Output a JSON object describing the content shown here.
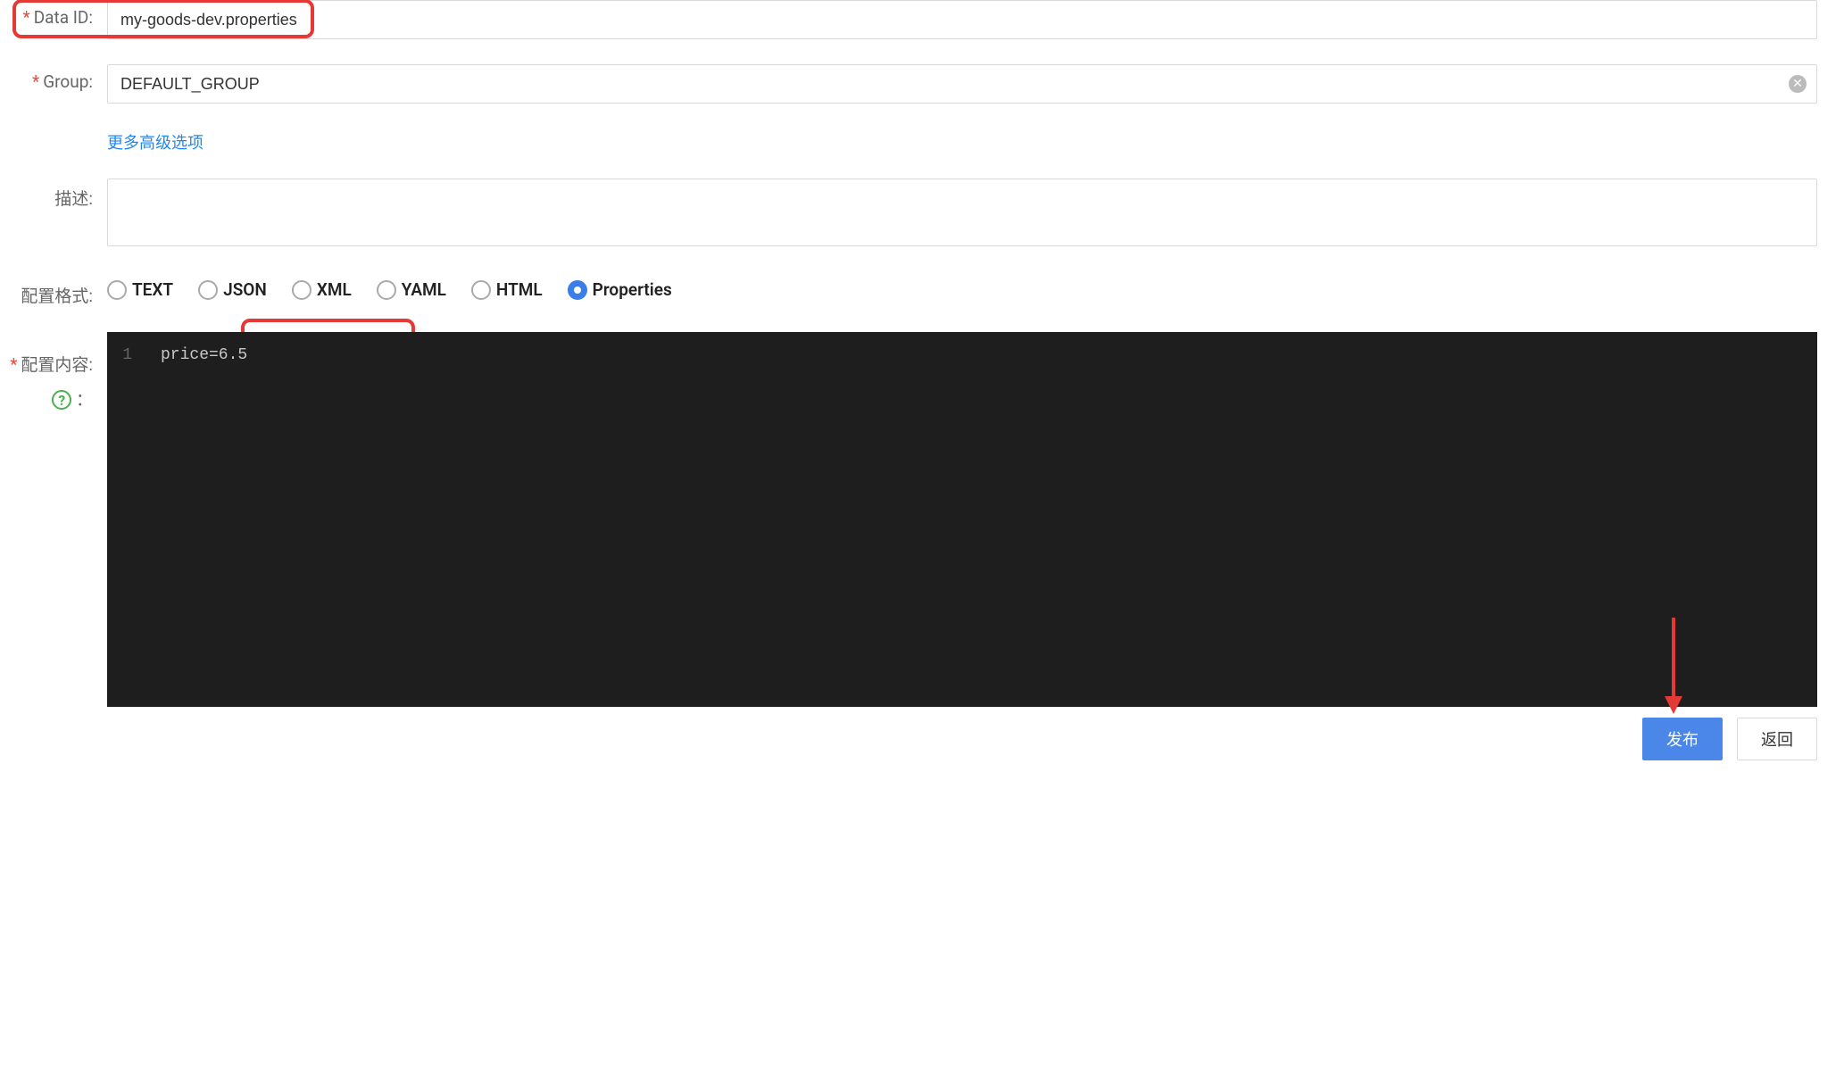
{
  "form": {
    "data_id": {
      "label": "Data ID:",
      "value": "my-goods-dev.properties"
    },
    "group": {
      "label": "Group:",
      "value": "DEFAULT_GROUP"
    },
    "more_options_link": "更多高级选项",
    "description": {
      "label": "描述:",
      "value": ""
    },
    "format": {
      "label": "配置格式:",
      "options": [
        {
          "label": "TEXT",
          "selected": false
        },
        {
          "label": "JSON",
          "selected": false
        },
        {
          "label": "XML",
          "selected": false
        },
        {
          "label": "YAML",
          "selected": false
        },
        {
          "label": "HTML",
          "selected": false
        },
        {
          "label": "Properties",
          "selected": true
        }
      ]
    },
    "content": {
      "label": "配置内容:",
      "help_suffix": "：",
      "lines": [
        {
          "number": "1",
          "text": "price=6.5"
        }
      ]
    }
  },
  "buttons": {
    "publish": "发布",
    "back": "返回"
  }
}
